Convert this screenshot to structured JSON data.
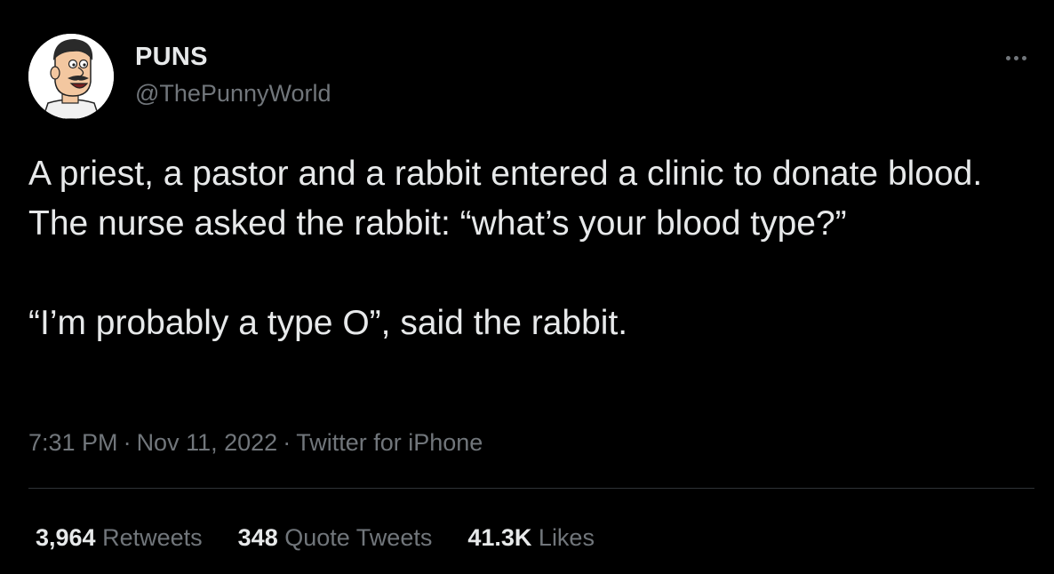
{
  "user": {
    "display_name": "PUNS",
    "handle": "@ThePunnyWorld",
    "avatar_icon": "cartoon-man-avatar"
  },
  "more_icon": "ellipsis-icon",
  "tweet": {
    "paragraphs": [
      "A priest, a pastor and a rabbit entered a clinic to donate blood. The nurse asked the rabbit: “what’s your blood type?”",
      "“I’m probably a type O”, said the rabbit."
    ]
  },
  "meta": {
    "time": "7:31 PM",
    "date": "Nov 11, 2022",
    "separator": "·",
    "source": "Twitter for iPhone"
  },
  "stats": {
    "retweets_count": "3,964",
    "retweets_label": "Retweets",
    "quotes_count": "348",
    "quotes_label": "Quote Tweets",
    "likes_count": "41.3K",
    "likes_label": "Likes"
  },
  "colors": {
    "background": "#000000",
    "primary_text": "#e7e9ea",
    "secondary_text": "#71767b",
    "divider": "#2f3336"
  }
}
